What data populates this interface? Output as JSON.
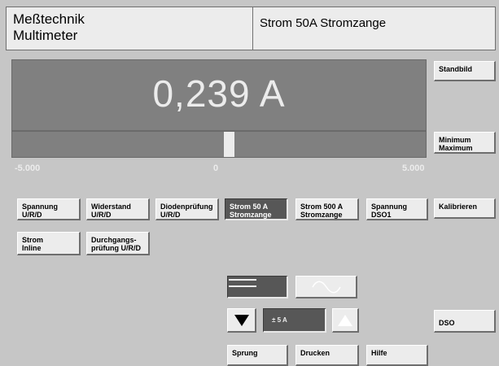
{
  "header": {
    "title_line1": "Meßtechnik",
    "title_line2": "Multimeter",
    "mode": "Strom 50A Stromzange"
  },
  "display": {
    "reading": "0,239 A",
    "bar_value": 0.239,
    "scale_min": "-5.000",
    "scale_zero": "0",
    "scale_max": "5.000"
  },
  "side_buttons": {
    "standbild": "Standbild",
    "minmax_l1": "Minimum",
    "minmax_l2": "Maximum",
    "kalibrieren": "Kalibrieren",
    "dso": "DSO"
  },
  "modes": [
    {
      "l1": "Spannung",
      "l2": "U/R/D",
      "active": false
    },
    {
      "l1": "Widerstand",
      "l2": "U/R/D",
      "active": false
    },
    {
      "l1": "Diodenprüfung",
      "l2": "U/R/D",
      "active": false
    },
    {
      "l1": "Strom  50 A",
      "l2": "Stromzange",
      "active": true
    },
    {
      "l1": "Strom  500 A",
      "l2": "Stromzange",
      "active": false
    },
    {
      "l1": "Spannung",
      "l2": "DSO1",
      "active": false
    },
    {
      "l1": "Strom",
      "l2": "Inline",
      "active": false
    },
    {
      "l1": "Durchgangs-",
      "l2": "prüfung U/R/D",
      "active": false
    }
  ],
  "controls": {
    "dc_icon": "dc-lines-icon",
    "ac_icon": "sine-wave-icon",
    "range": "± 5 A",
    "down_icon": "triangle-down-icon",
    "up_icon": "triangle-up-icon"
  },
  "bottom": {
    "sprung": "Sprung",
    "drucken": "Drucken",
    "hilfe": "Hilfe"
  },
  "colors": {
    "background": "#c6c6c6",
    "panel": "#808080",
    "button": "#ececec",
    "active": "#575757"
  }
}
